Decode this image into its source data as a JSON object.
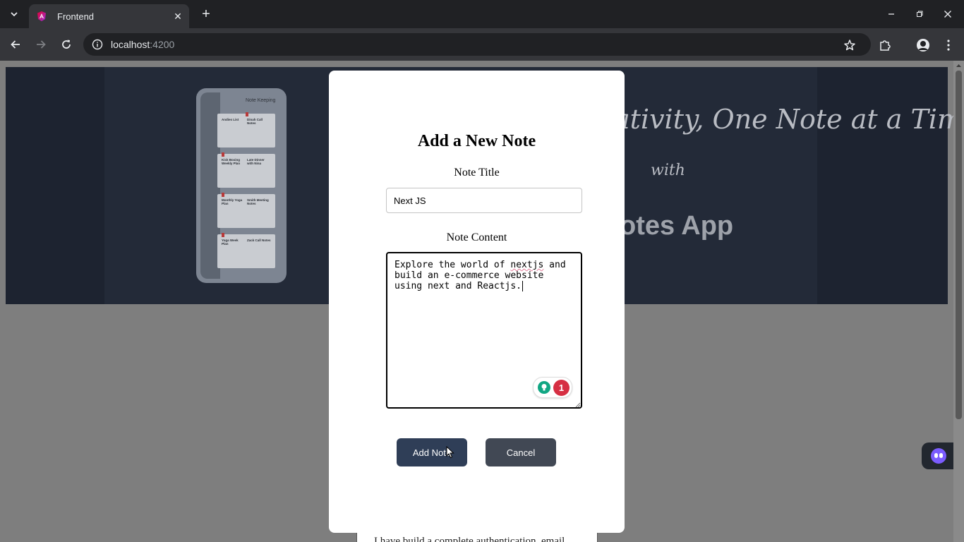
{
  "browser": {
    "tab_title": "Frontend",
    "url_host": "localhost",
    "url_port": ":4200"
  },
  "hero": {
    "phone_title": "Note Keeping",
    "cards": [
      {
        "left": "Andies List",
        "right": "Dinah Call Notes"
      },
      {
        "left": "Kick Boxing Weekly Plan",
        "right": "Late Dinner with Nina"
      },
      {
        "left": "Monthly Yoga Plan",
        "right": "Smith Meeting Notes"
      },
      {
        "left": "Yoga Week Plan",
        "right": "Zack Call Notes"
      }
    ],
    "line1": "ativity, One Note at a Time",
    "with": "with",
    "app": "otes App"
  },
  "modal": {
    "title": "Add a New Note",
    "title_label": "Note Title",
    "title_value": "Next JS",
    "content_label": "Note Content",
    "content_before": "Explore the world of ",
    "content_misspelled": "nextjs",
    "content_after": " and\nbuild an e-commerce website\nusing next and Reactjs.",
    "grammar_count": "1",
    "add_button": "Add Note",
    "cancel_button": "Cancel"
  },
  "background_text": "I have build a complete authentication, email",
  "colors": {
    "primary_button": "#2f3e57",
    "cancel_button": "#414854",
    "hero_bg": "#1d2330"
  }
}
